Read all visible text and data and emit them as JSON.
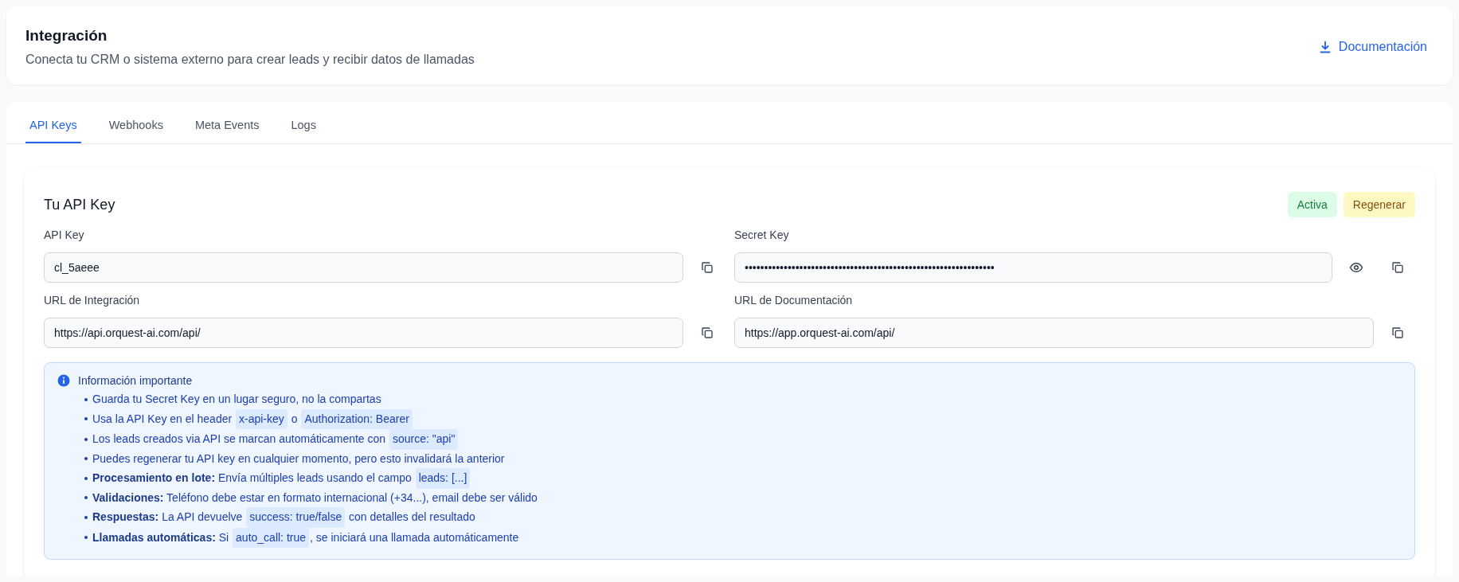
{
  "header": {
    "title": "Integración",
    "subtitle": "Conecta tu CRM o sistema externo para crear leads y recibir datos de llamadas",
    "doc_link": "Documentación"
  },
  "tabs": [
    {
      "label": "API Keys",
      "selected": true
    },
    {
      "label": "Webhooks",
      "selected": false
    },
    {
      "label": "Meta Events",
      "selected": false
    },
    {
      "label": "Logs",
      "selected": false
    }
  ],
  "card": {
    "title": "Tu API Key",
    "status_badge": "Activa",
    "regenerate_button": "Regenerar"
  },
  "fields": [
    {
      "label": "API Key",
      "value": "cl_5aeee",
      "reveal": false
    },
    {
      "label": "Secret Key",
      "value": "••••••••••••••••••••••••••••••••••••••••••••••••••••••••••••••••",
      "reveal": true
    },
    {
      "label": "URL de Integración",
      "value": "https://api.orquest-ai.com/api/",
      "reveal": false
    },
    {
      "label": "URL de Documentación",
      "value": "https://app.orquest-ai.com/api/",
      "reveal": false
    }
  ],
  "info": {
    "title": "Información importante",
    "items": [
      {
        "parts": [
          {
            "kind": "text",
            "text": "Guarda tu Secret Key en un lugar seguro, no la compartas"
          }
        ]
      },
      {
        "parts": [
          {
            "kind": "text",
            "text": "Usa la API Key en el header "
          },
          {
            "kind": "code",
            "text": "x-api-key"
          },
          {
            "kind": "text",
            "text": " o "
          },
          {
            "kind": "code",
            "text": "Authorization: Bearer"
          }
        ]
      },
      {
        "parts": [
          {
            "kind": "text",
            "text": "Los leads creados via API se marcan automáticamente con "
          },
          {
            "kind": "code",
            "text": "source: \"api\""
          }
        ]
      },
      {
        "parts": [
          {
            "kind": "text",
            "text": "Puedes regenerar tu API key en cualquier momento, pero esto invalidará la anterior"
          }
        ]
      },
      {
        "label": "Procesamiento en lote:",
        "parts": [
          {
            "kind": "text",
            "text": " Envía múltiples leads usando el campo "
          },
          {
            "kind": "code",
            "text": "leads: [...]"
          }
        ]
      },
      {
        "label": "Validaciones:",
        "parts": [
          {
            "kind": "text",
            "text": " Teléfono debe estar en formato internacional (+34...), email debe ser válido"
          }
        ]
      },
      {
        "label": "Respuestas:",
        "parts": [
          {
            "kind": "text",
            "text": " La API devuelve "
          },
          {
            "kind": "code",
            "text": "success: true/false"
          },
          {
            "kind": "text",
            "text": " con detalles del resultado"
          }
        ]
      },
      {
        "label": "Llamadas automáticas:",
        "parts": [
          {
            "kind": "text",
            "text": " Si "
          },
          {
            "kind": "code",
            "text": "auto_call: true"
          },
          {
            "kind": "text",
            "text": ", se iniciará una llamada automáticamente"
          }
        ]
      }
    ]
  }
}
